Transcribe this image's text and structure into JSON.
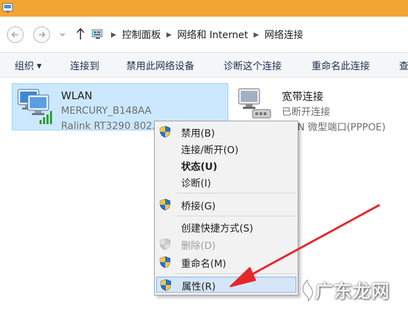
{
  "addressbar": {
    "breadcrumbs": [
      "控制面板",
      "网络和 Internet",
      "网络连接"
    ]
  },
  "toolbar": {
    "organize": "组织",
    "connect_to": "连接到",
    "disable_device": "禁用此网络设备",
    "diagnose": "诊断这个连接",
    "rename": "重命名此连接",
    "more": "查"
  },
  "connections": [
    {
      "name": "WLAN",
      "line2": "MERCURY_B148AA",
      "line3": "Ralink RT3290 802.11bgn Wi-Fi",
      "selected": true
    },
    {
      "name": "宽带连接",
      "line2": "已断开连接",
      "line3": "WAN 微型端口(PPPOE)",
      "selected": false
    }
  ],
  "context_menu": {
    "items": [
      {
        "label": "禁用(B)",
        "shield": true
      },
      {
        "label": "连接/断开(O)",
        "shield": false
      },
      {
        "label": "状态(U)",
        "shield": false,
        "bold": true
      },
      {
        "label": "诊断(I)",
        "shield": false
      },
      {
        "label": "桥接(G)",
        "shield": true
      },
      {
        "label": "创建快捷方式(S)",
        "shield": false
      },
      {
        "label": "删除(D)",
        "shield": true,
        "disabled": true
      },
      {
        "label": "重命名(M)",
        "shield": true
      },
      {
        "label": "属性(R)",
        "shield": true,
        "highlighted": true
      }
    ]
  },
  "watermark": {
    "text": "广东龙网"
  },
  "colors": {
    "titlebar": "#f3a533",
    "selection": "#cce8ff",
    "menu_highlight": "#d6e6f7",
    "arrow": "#e5262b"
  }
}
